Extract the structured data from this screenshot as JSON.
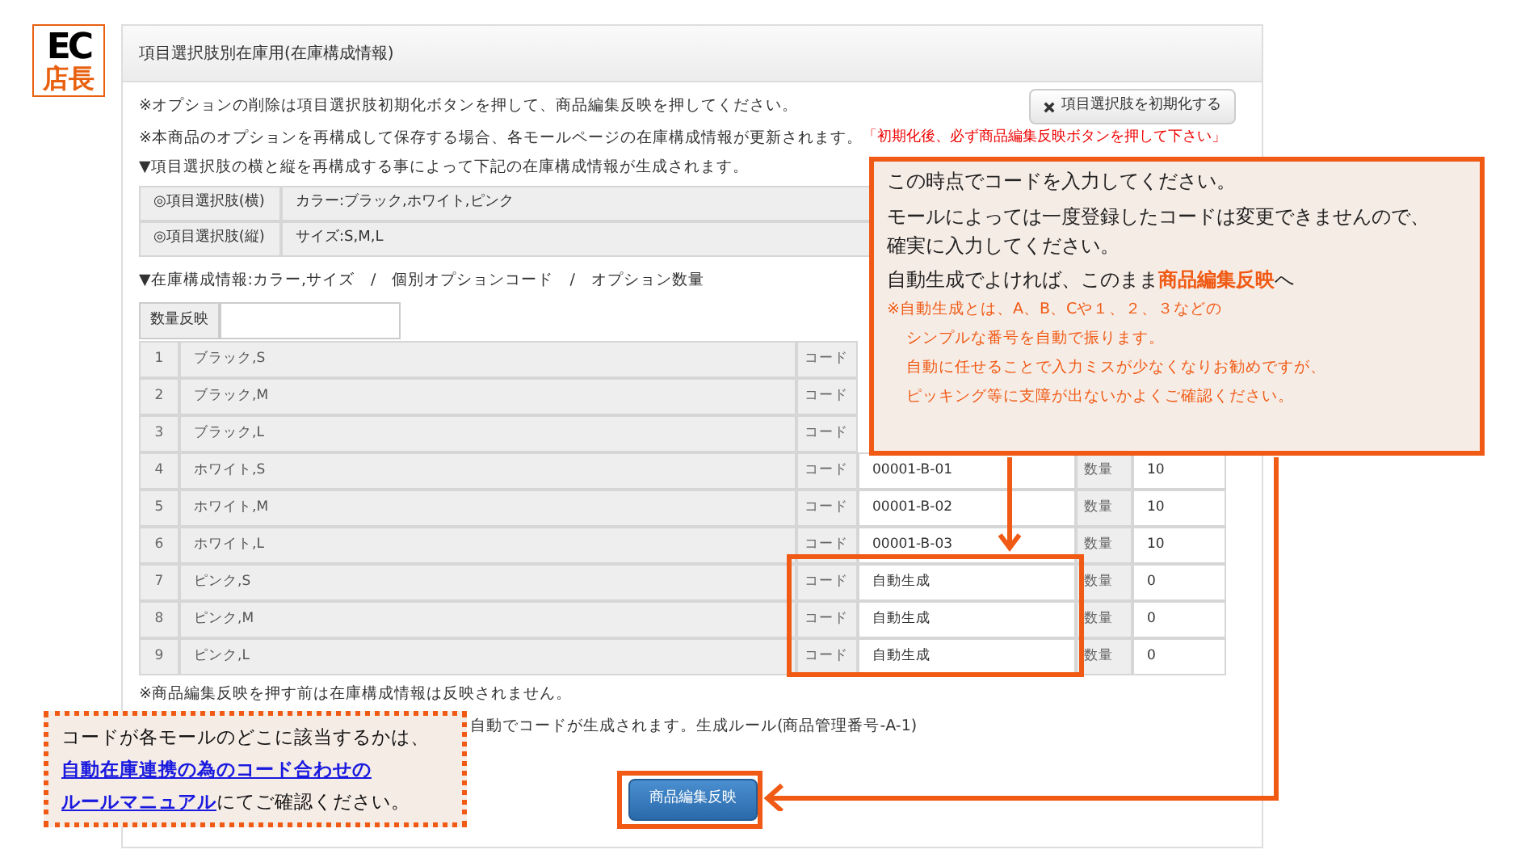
{
  "logo": {
    "top": "EC",
    "bottom": "店長"
  },
  "panel": {
    "title": "項目選択肢別在庫用(在庫構成情報)",
    "notes": [
      "※オプションの削除は項目選択肢初期化ボタンを押して、商品編集反映を押してください。",
      "※本商品のオプションを再構成して保存する場合、各モールページの在庫構成情報が更新されます。",
      "▼項目選択肢の横と縦を再構成する事によって下記の在庫構成情報が生成されます。"
    ],
    "warning": "「初期化後、必ず商品編集反映ボタンを押して下さい」",
    "reset_button": "項目選択肢を初期化する",
    "options": [
      {
        "label": "◎項目選択肢(横)",
        "value": "カラー:ブラック,ホワイト,ピンク"
      },
      {
        "label": "◎項目選択肢(縦)",
        "value": "サイズ:S,M,L"
      }
    ],
    "stock_heading": "▼在庫構成情報:カラー,サイズ　/　個別オプションコード　/　オプション数量",
    "qty_button": "数量反映",
    "rows": [
      {
        "no": "1",
        "name": "ブラック,S",
        "code_label": "コード"
      },
      {
        "no": "2",
        "name": "ブラック,M",
        "code_label": "コード"
      },
      {
        "no": "3",
        "name": "ブラック,L",
        "code_label": "コード"
      },
      {
        "no": "4",
        "name": "ホワイト,S",
        "code_label": "コード",
        "code": "00001-B-01",
        "qty_label": "数量",
        "qty": "10"
      },
      {
        "no": "5",
        "name": "ホワイト,M",
        "code_label": "コード",
        "code": "00001-B-02",
        "qty_label": "数量",
        "qty": "10"
      },
      {
        "no": "6",
        "name": "ホワイト,L",
        "code_label": "コード",
        "code": "00001-B-03",
        "qty_label": "数量",
        "qty": "10"
      },
      {
        "no": "7",
        "name": "ピンク,S",
        "code_label": "コード",
        "code": "自動生成",
        "qty_label": "数量",
        "qty": "0"
      },
      {
        "no": "8",
        "name": "ピンク,M",
        "code_label": "コード",
        "code": "自動生成",
        "qty_label": "数量",
        "qty": "0"
      },
      {
        "no": "9",
        "name": "ピンク,L",
        "code_label": "コード",
        "code": "自動生成",
        "qty_label": "数量",
        "qty": "0"
      }
    ],
    "footer_notes": [
      "※商品編集反映を押す前は在庫構成情報は反映されません。",
      "自動でコードが生成されます。生成ルール(商品管理番号-A-1)"
    ],
    "submit_button": "商品編集反映"
  },
  "callout": {
    "lines": [
      "この時点でコードを入力してください。",
      "モールによっては一度登録したコードは変更できませんので、確実に入力してください。",
      "自動生成でよければ、このまま**商品編集反映**へ"
    ],
    "notes": [
      "※自動生成とは、A、B、Cや１、２、３などの",
      "シンプルな番号を自動で振ります。",
      "自動に任せることで入力ミスが少なくなりお勧めですが、",
      "ピッキング等に支障が出ないかよくご確認ください。"
    ]
  },
  "manual_note": {
    "text": "コードが各モールのどこに該当するかは、",
    "link_lines": [
      "自動在庫連携の為のコード合わせの",
      "ルールマニュアル"
    ],
    "suffix": "にてご確認ください。"
  }
}
